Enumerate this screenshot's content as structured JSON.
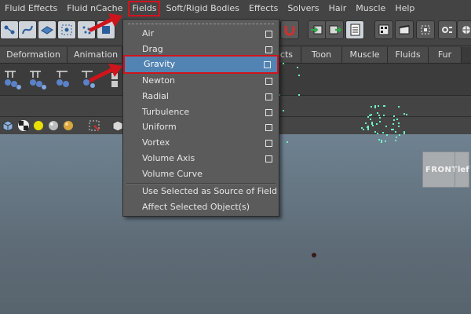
{
  "menu_bar": [
    "Fluid Effects",
    "Fluid nCache",
    "Fields",
    "Soft/Rigid Bodies",
    "Effects",
    "Solvers",
    "Hair",
    "Muscle",
    "Help"
  ],
  "highlighted_menu": "Fields",
  "shelf_tabs": [
    "Deformation",
    "Animation",
    "ects",
    "Toon",
    "Muscle",
    "Fluids",
    "Fur"
  ],
  "fields_menu": {
    "items": [
      {
        "label": "Air",
        "option_box": true
      },
      {
        "label": "Drag",
        "option_box": true
      },
      {
        "label": "Gravity",
        "option_box": true,
        "selected": true
      },
      {
        "label": "Newton",
        "option_box": true
      },
      {
        "label": "Radial",
        "option_box": true
      },
      {
        "label": "Turbulence",
        "option_box": true
      },
      {
        "label": "Uniform",
        "option_box": true
      },
      {
        "label": "Vortex",
        "option_box": true
      },
      {
        "label": "Volume Axis",
        "option_box": true
      },
      {
        "label": "Volume Curve",
        "option_box": false
      }
    ],
    "extra_items": [
      "Use Selected as Source of Field",
      "Affect Selected Object(s)"
    ]
  },
  "view_cube": {
    "front": "FRONT",
    "side": "lef"
  },
  "colors": {
    "highlight_outline": "#d0141c",
    "menu_selection": "#5284b3",
    "particles": "#70f2c4"
  }
}
